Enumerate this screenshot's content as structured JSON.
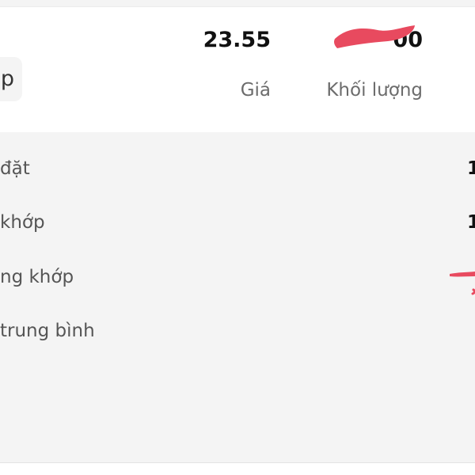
{
  "order_summary": {
    "side_label": "p",
    "price": {
      "value": "23.55",
      "label": "Giá"
    },
    "volume": {
      "value": "00",
      "label": "Khối lượng"
    }
  },
  "details": [
    {
      "label": "đặt",
      "value": "1"
    },
    {
      "label": "khớp",
      "value": "1"
    },
    {
      "label": "ng khớp",
      "value": ""
    },
    {
      "label": "trung bình",
      "value": ""
    }
  ],
  "colors": {
    "redaction": "#e84a5f",
    "card_background": "#ffffff",
    "panel_background": "#f4f4f4"
  }
}
